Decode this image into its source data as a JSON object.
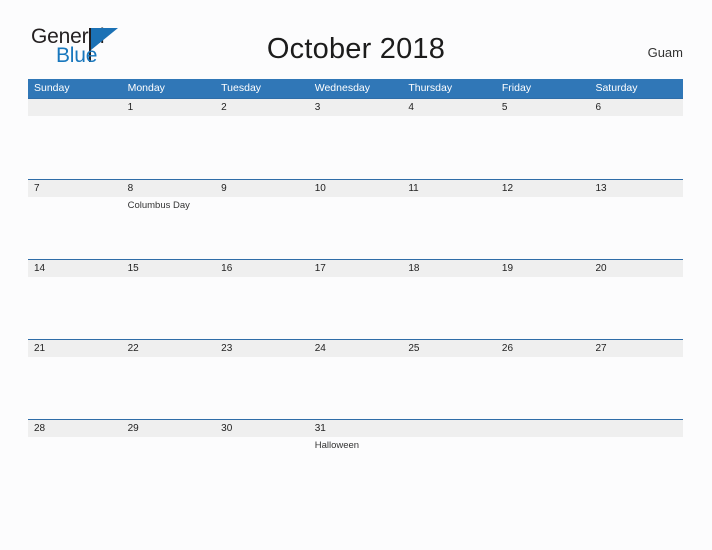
{
  "brand": {
    "name_part1": "General",
    "name_part2": "Blue",
    "accent_color": "#1877bd",
    "triangle_icon": "logo-triangle-icon"
  },
  "header": {
    "title": "October 2018",
    "locale": "Guam"
  },
  "calendar": {
    "header_bg": "#3077b7",
    "number_row_bg": "#efefef",
    "rule_color": "#2f6da8",
    "weekdays": [
      "Sunday",
      "Monday",
      "Tuesday",
      "Wednesday",
      "Thursday",
      "Friday",
      "Saturday"
    ],
    "weeks": [
      {
        "days": [
          {
            "num": "",
            "events": []
          },
          {
            "num": "1",
            "events": []
          },
          {
            "num": "2",
            "events": []
          },
          {
            "num": "3",
            "events": []
          },
          {
            "num": "4",
            "events": []
          },
          {
            "num": "5",
            "events": []
          },
          {
            "num": "6",
            "events": []
          }
        ]
      },
      {
        "days": [
          {
            "num": "7",
            "events": []
          },
          {
            "num": "8",
            "events": [
              "Columbus Day"
            ]
          },
          {
            "num": "9",
            "events": []
          },
          {
            "num": "10",
            "events": []
          },
          {
            "num": "11",
            "events": []
          },
          {
            "num": "12",
            "events": []
          },
          {
            "num": "13",
            "events": []
          }
        ]
      },
      {
        "days": [
          {
            "num": "14",
            "events": []
          },
          {
            "num": "15",
            "events": []
          },
          {
            "num": "16",
            "events": []
          },
          {
            "num": "17",
            "events": []
          },
          {
            "num": "18",
            "events": []
          },
          {
            "num": "19",
            "events": []
          },
          {
            "num": "20",
            "events": []
          }
        ]
      },
      {
        "days": [
          {
            "num": "21",
            "events": []
          },
          {
            "num": "22",
            "events": []
          },
          {
            "num": "23",
            "events": []
          },
          {
            "num": "24",
            "events": []
          },
          {
            "num": "25",
            "events": []
          },
          {
            "num": "26",
            "events": []
          },
          {
            "num": "27",
            "events": []
          }
        ]
      },
      {
        "days": [
          {
            "num": "28",
            "events": []
          },
          {
            "num": "29",
            "events": []
          },
          {
            "num": "30",
            "events": []
          },
          {
            "num": "31",
            "events": [
              "Halloween"
            ]
          },
          {
            "num": "",
            "events": []
          },
          {
            "num": "",
            "events": []
          },
          {
            "num": "",
            "events": []
          }
        ]
      }
    ]
  }
}
